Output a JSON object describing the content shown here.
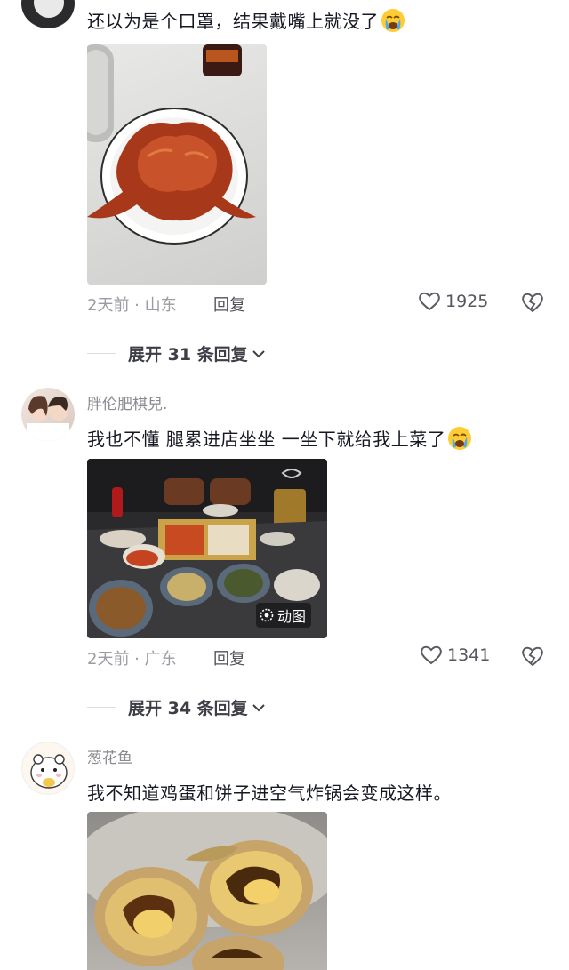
{
  "comments": [
    {
      "text": "还以为是个口罩，结果戴嘴上就没了",
      "emoji": "crying-face-icon",
      "time": "2天前 · 山东",
      "reply_label": "回复",
      "likes": "1925",
      "expand_label": "展开 31 条回复"
    },
    {
      "username": "胖伦肥棋兒.",
      "text": "我也不懂 腿累进店坐坐 一坐下就给我上菜了",
      "emoji": "crying-face-icon",
      "badge": "动图",
      "time": "2天前 · 广东",
      "reply_label": "回复",
      "likes": "1341",
      "expand_label": "展开 34 条回复"
    },
    {
      "username": "葱花鱼",
      "text": "我不知道鸡蛋和饼子进空气炸锅会变成这样。"
    }
  ],
  "colors": {
    "text": "#161823",
    "muted": "#8a8b91",
    "background": "#ffffff"
  }
}
